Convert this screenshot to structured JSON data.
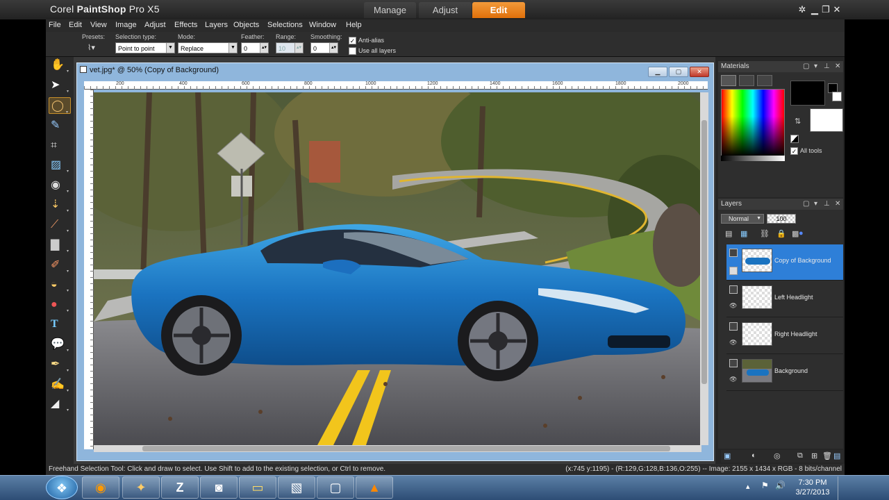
{
  "app": {
    "brand": "Corel",
    "name": "PaintShop",
    "suffix": "Pro X5",
    "workspace_tabs": [
      "Manage",
      "Adjust",
      "Edit"
    ],
    "active_tab": "Edit"
  },
  "menu": [
    "File",
    "Edit",
    "View",
    "Image",
    "Adjust",
    "Effects",
    "Layers",
    "Objects",
    "Selections",
    "Window",
    "Help"
  ],
  "options": {
    "presets_label": "Presets:",
    "selection_type_label": "Selection type:",
    "selection_type_value": "Point to point",
    "mode_label": "Mode:",
    "mode_value": "Replace",
    "feather_label": "Feather:",
    "feather_value": "0",
    "range_label": "Range:",
    "range_value": "10",
    "smoothing_label": "Smoothing:",
    "smoothing_value": "0",
    "anti_alias_label": "Anti-alias",
    "anti_alias_checked": true,
    "use_all_layers_label": "Use all layers",
    "use_all_layers_checked": false
  },
  "tools": [
    "pan-icon",
    "pick-icon",
    "freehand-selection-icon",
    "dropper-icon",
    "crop-icon",
    "straighten-icon",
    "red-eye-icon",
    "makeover-icon",
    "clone-brush-icon",
    "gradient-icon",
    "paint-brush-icon",
    "fill-icon",
    "color-replacer-icon",
    "text-icon",
    "shape-icon",
    "pen-icon",
    "retouch-brush-icon",
    "eraser-icon"
  ],
  "document": {
    "title": "vet.jpg* @  50% (Copy of Background)",
    "ruler_ticks": [
      "200",
      "400",
      "600",
      "800",
      "1000",
      "1200",
      "1400",
      "1600",
      "1800",
      "2000"
    ]
  },
  "materials": {
    "title": "Materials",
    "all_tools_label": "All tools",
    "all_tools_checked": true
  },
  "layers": {
    "title": "Layers",
    "blend_mode": "Normal",
    "opacity": "100",
    "items": [
      {
        "name": "Copy of Background",
        "selected": true
      },
      {
        "name": "Left Headlight",
        "selected": false
      },
      {
        "name": "Right Headlight",
        "selected": false
      },
      {
        "name": "Background",
        "selected": false
      }
    ]
  },
  "status": {
    "hint": "Freehand Selection Tool: Click and draw to select. Use Shift to add to the existing selection, or Ctrl to remove.",
    "info": "(x:745 y:1195) - (R:129,G:128,B:136,O:255) -- Image:  2155 x 1434 x RGB - 8 bits/channel"
  },
  "taskbar": {
    "time": "7:30 PM",
    "date": "3/27/2013"
  }
}
